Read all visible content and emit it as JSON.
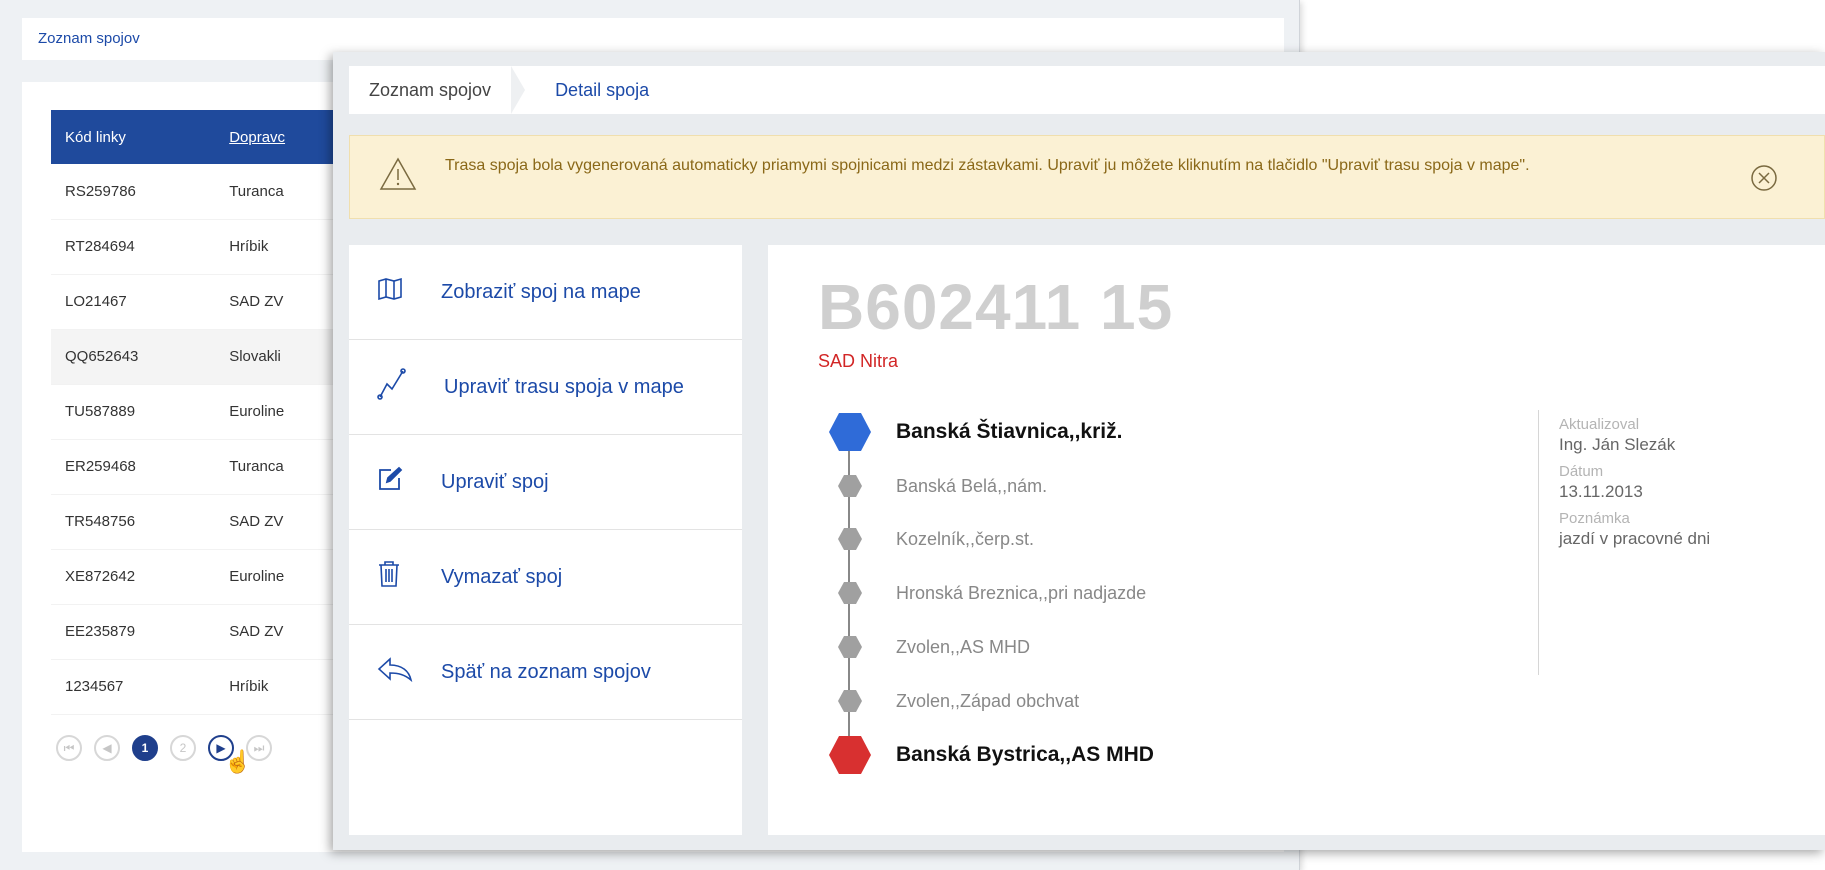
{
  "background": {
    "breadcrumb": "Zoznam spojov",
    "table": {
      "headers": [
        "Kód linky",
        "Dopravc"
      ],
      "rows": [
        [
          "RS259786",
          "Turanca"
        ],
        [
          "RT284694",
          "Hríbik"
        ],
        [
          "LO21467",
          "SAD ZV"
        ],
        [
          "QQ652643",
          "Slovakli"
        ],
        [
          "TU587889",
          "Euroline"
        ],
        [
          "ER259468",
          "Turanca"
        ],
        [
          "TR548756",
          "SAD ZV"
        ],
        [
          "XE872642",
          "Euroline"
        ],
        [
          "EE235879",
          "SAD ZV"
        ],
        [
          "1234567",
          "Hríbik"
        ]
      ]
    },
    "pager": {
      "pages": [
        "1",
        "2"
      ],
      "current": "1"
    }
  },
  "detail": {
    "breadcrumb": [
      "Zoznam spojov",
      "Detail spoja"
    ],
    "alert": {
      "text": "Trasa spoja bola vygenerovaná automaticky priamymi spojnicami medzi zástavkami. Upraviť ju môžete kliknutím na tlačidlo \"Upraviť trasu spoja v mape\"."
    },
    "menu": [
      {
        "label": "Zobraziť spoj na mape",
        "icon": "map-icon"
      },
      {
        "label": "Upraviť trasu spoja v mape",
        "icon": "route-edit-icon"
      },
      {
        "label": "Upraviť spoj",
        "icon": "edit-icon"
      },
      {
        "label": "Vymazať spoj",
        "icon": "trash-icon"
      },
      {
        "label": "Späť na zoznam spojov",
        "icon": "back-arrow-icon"
      }
    ],
    "line_code": "B602411 15",
    "operator": "SAD Nitra",
    "stops": [
      "Banská Štiavnica,,križ.",
      "Banská Belá,,nám.",
      "Kozelník,,čerp.st.",
      "Hronská Breznica,,pri nadjazde",
      "Zvolen,,AS MHD",
      "Zvolen,,Západ obchvat",
      "Banská Bystrica,,AS MHD"
    ],
    "meta": {
      "updated_by_label": "Aktualizoval",
      "updated_by": "Ing. Ján Slezák",
      "date_label": "Dátum",
      "date": "13.11.2013",
      "note_label": "Poznámka",
      "note": "jazdí v pracovné dni"
    },
    "colors": {
      "accent": "#1c4aa8",
      "start_stop": "#2f6bd8",
      "end_stop": "#d83030",
      "mid_stop": "#a0a0a0",
      "operator": "#d22626"
    }
  }
}
